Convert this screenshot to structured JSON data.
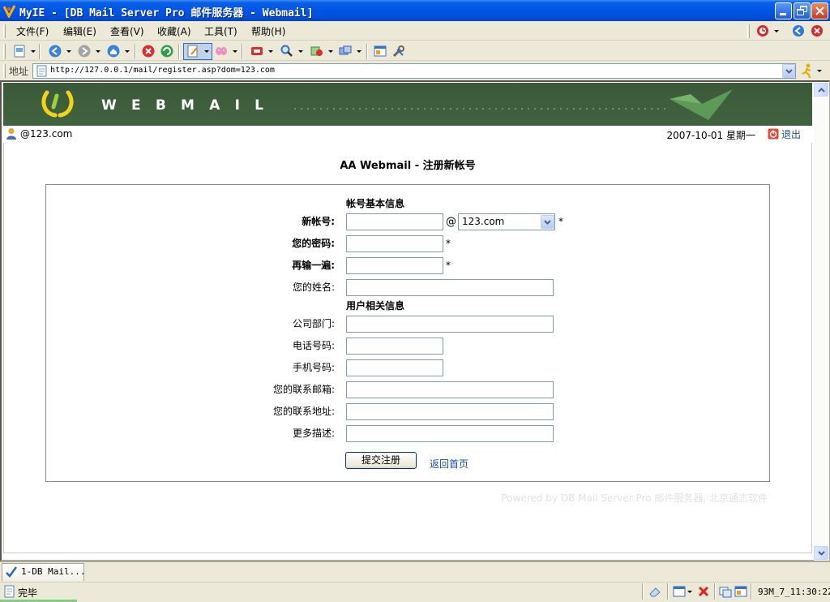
{
  "window": {
    "title": "MyIE - [DB Mail Server Pro 邮件服务器 - Webmail]",
    "accent": "#0055e5"
  },
  "menu": {
    "items": [
      "文件(F)",
      "编辑(E)",
      "查看(V)",
      "收藏(A)",
      "工具(T)",
      "帮助(H)"
    ]
  },
  "address": {
    "label": "地址",
    "url": "http://127.0.0.1/mail/register.asp?dom=123.com"
  },
  "banner": {
    "logo_text": "WEBMAIL",
    "background": "#3f5f3d"
  },
  "userbar": {
    "user": "@123.com",
    "date": "2007-10-01 星期一",
    "logout": "退出"
  },
  "page": {
    "title": "AA Webmail - 注册新帐号"
  },
  "form": {
    "section_account": "帐号基本信息",
    "section_user": "用户相关信息",
    "new_account_label": "新帐号:",
    "at_sign": "@",
    "domain_selected": "123.com",
    "required_mark": "*",
    "password_label": "您的密码:",
    "confirm_label": "再输一遍:",
    "name_label": "您的姓名:",
    "department_label": "公司部门:",
    "phone_label": "电话号码:",
    "mobile_label": "手机号码:",
    "contact_email_label": "您的联系邮箱:",
    "contact_address_label": "您的联系地址:",
    "description_label": "更多描述:",
    "submit_label": "提交注册",
    "home_link": "返回首页",
    "link_color": "#1a4aa0"
  },
  "footer": {
    "text": "Powered by DB Mail Server Pro 邮件服务器, 北京通志软件"
  },
  "tabs": [
    {
      "label": "1-DB Mail..."
    }
  ],
  "status": {
    "text": "完毕",
    "clock": "93M_7_11:30:22"
  }
}
